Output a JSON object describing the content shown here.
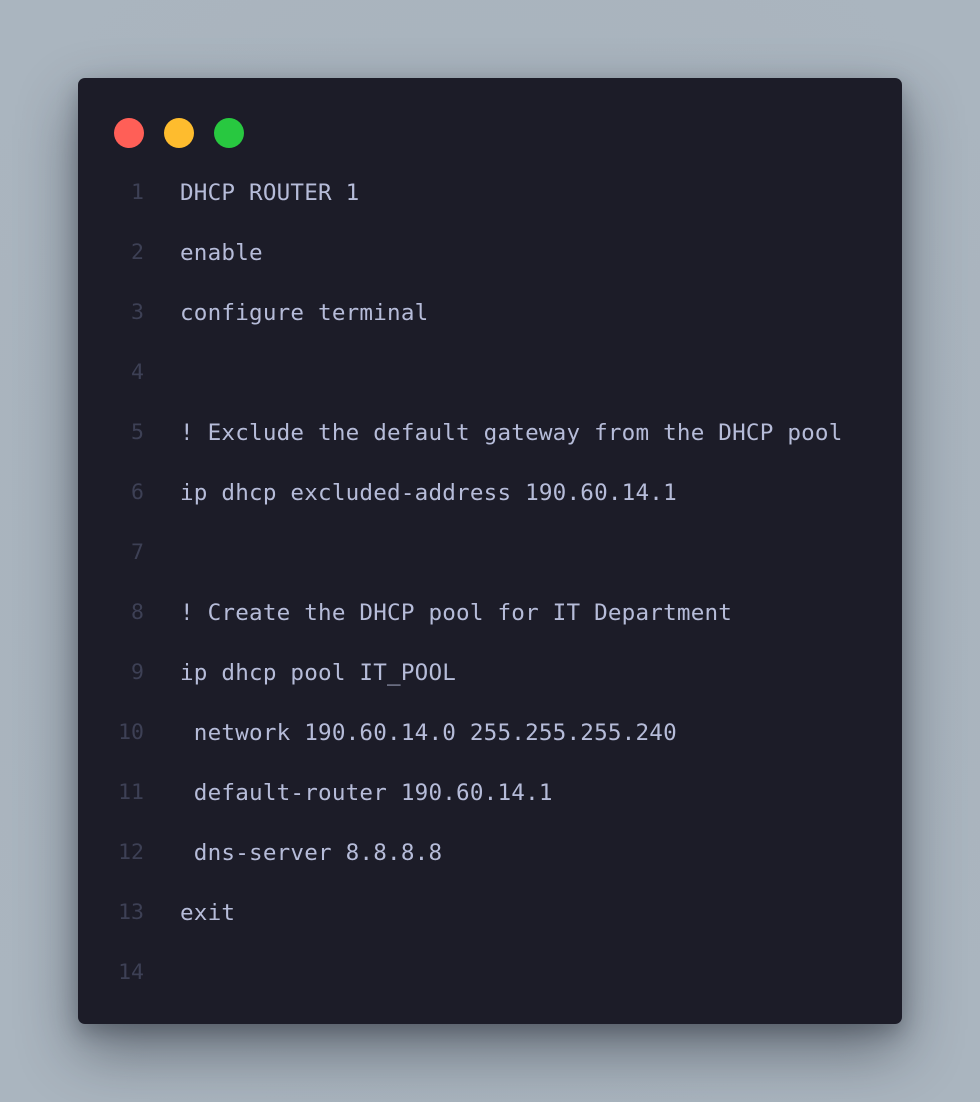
{
  "window": {
    "controls": [
      {
        "name": "close",
        "color": "#ff5f57"
      },
      {
        "name": "minimize",
        "color": "#febc2e"
      },
      {
        "name": "maximize",
        "color": "#28c840"
      }
    ]
  },
  "code": {
    "lines": [
      {
        "number": "1",
        "text": "DHCP ROUTER 1"
      },
      {
        "number": "2",
        "text": "enable"
      },
      {
        "number": "3",
        "text": "configure terminal"
      },
      {
        "number": "4",
        "text": ""
      },
      {
        "number": "5",
        "text": "! Exclude the default gateway from the DHCP pool"
      },
      {
        "number": "6",
        "text": "ip dhcp excluded-address 190.60.14.1"
      },
      {
        "number": "7",
        "text": ""
      },
      {
        "number": "8",
        "text": "! Create the DHCP pool for IT Department"
      },
      {
        "number": "9",
        "text": "ip dhcp pool IT_POOL"
      },
      {
        "number": "10",
        "text": " network 190.60.14.0 255.255.255.240"
      },
      {
        "number": "11",
        "text": " default-router 190.60.14.1"
      },
      {
        "number": "12",
        "text": " dns-server 8.8.8.8"
      },
      {
        "number": "13",
        "text": "exit"
      },
      {
        "number": "14",
        "text": ""
      }
    ]
  }
}
